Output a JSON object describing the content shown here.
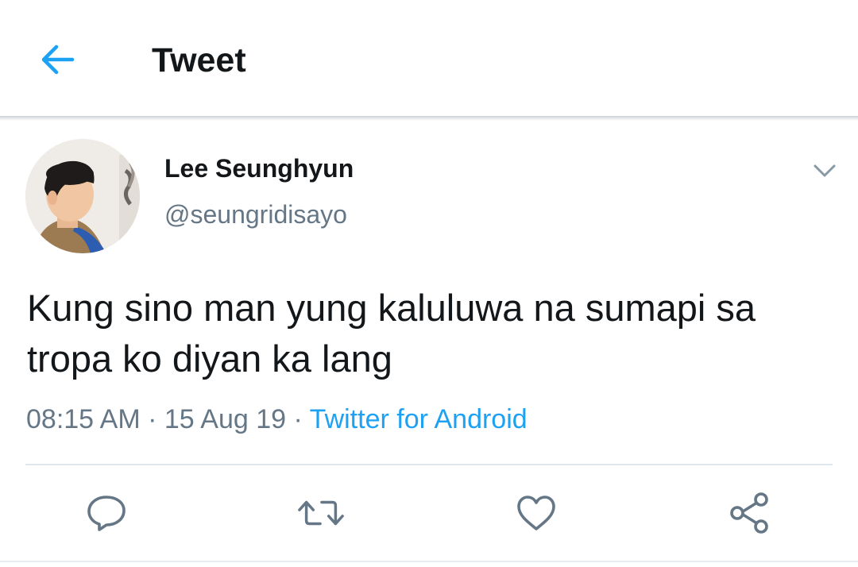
{
  "header": {
    "title": "Tweet",
    "back_icon": "arrow-left-icon",
    "accent_color": "#1da1f2"
  },
  "tweet": {
    "author_name": "Lee Seunghyun",
    "author_handle": "@seungridisayo",
    "text": "Kung sino man yung kaluluwa na sumapi sa tropa ko diyan ka lang",
    "time": "08:15 AM",
    "separator": "·",
    "date": "15 Aug 19",
    "source": "Twitter for Android",
    "more_icon": "chevron-down-icon"
  },
  "actions": {
    "icons": [
      "reply-icon",
      "retweet-icon",
      "like-icon",
      "share-icon"
    ]
  },
  "colors": {
    "text_primary": "#14171a",
    "text_secondary": "#657786",
    "link": "#1da1f2",
    "icon": "#657786",
    "divider": "#e1e8ed"
  }
}
